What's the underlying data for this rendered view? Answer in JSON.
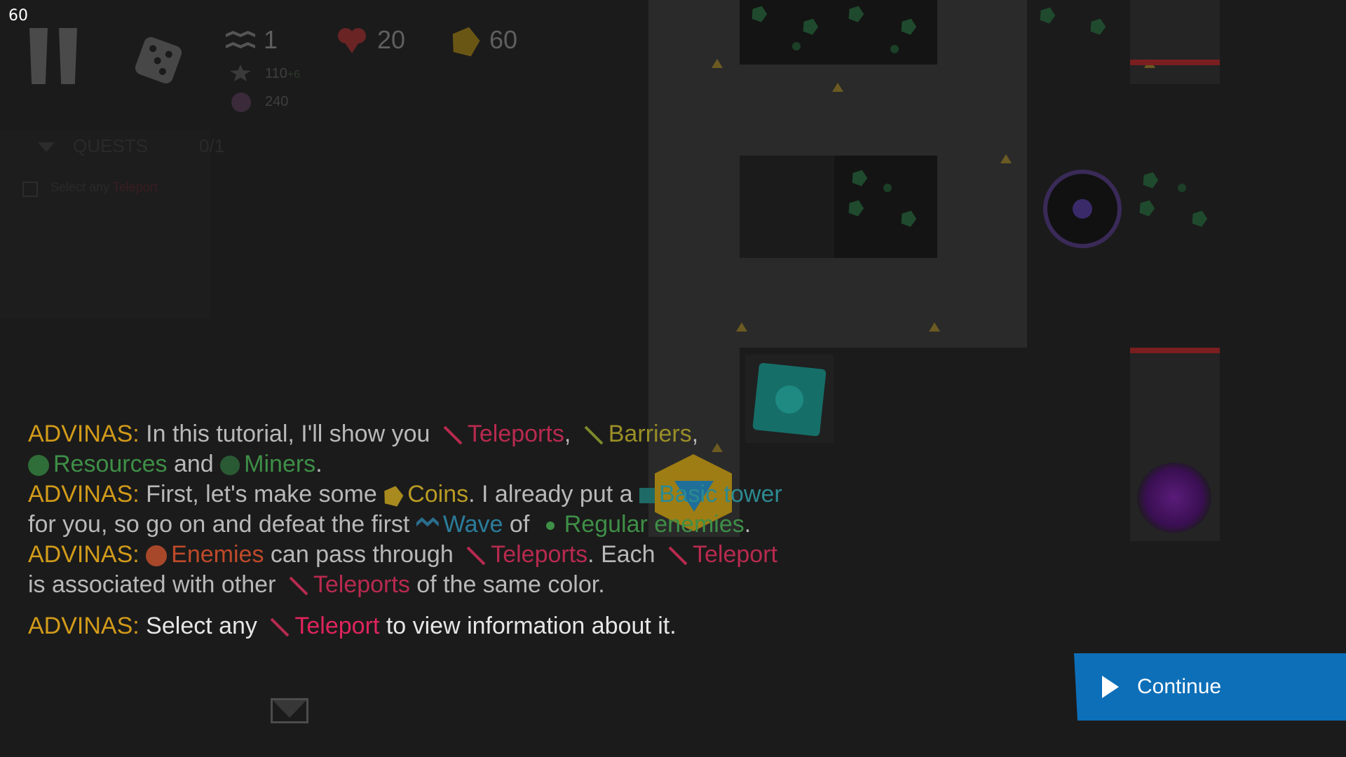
{
  "fps": "60",
  "hud": {
    "wave": "1",
    "lives": "20",
    "coins": "60",
    "score": "110",
    "score_bonus": "+6",
    "mops": "240"
  },
  "quests": {
    "title": "QUESTS",
    "progress": "0/1",
    "item": "Select any",
    "item_keyword": "Teleport"
  },
  "dialog": {
    "speaker": "ADVINAS:",
    "lines": [
      {
        "t1": "In this tutorial, I'll show you",
        "k1": "Teleports",
        "sep1": ",",
        "k2": "Barriers",
        "sep2": ",",
        "k3": "Resources",
        "t2": "and",
        "k4": "Miners",
        "end": "."
      },
      {
        "t1": "First, let's make some",
        "k1": "Coins",
        "t2": ". I already put a",
        "k2": "Basic tower",
        "t3": "for you, so go on and defeat the first",
        "k3": "Wave",
        "t4": "of",
        "k4": "Regular enemies",
        "end": "."
      },
      {
        "k1": "Enemies",
        "t1": "can pass through",
        "k2": "Teleports",
        "t2": ". Each",
        "k3": "Teleport",
        "t3": "is associated with other",
        "k4": "Teleports",
        "t4": "of the same color."
      },
      {
        "t1": "Select any",
        "k1": "Teleport",
        "t2": "to view information about it."
      }
    ]
  },
  "continue_label": "Continue",
  "icons": [
    "pause-icon",
    "dice-icon",
    "wave-icon",
    "heart-icon",
    "coin-icon",
    "mail-icon",
    "play-icon"
  ],
  "colors": {
    "speaker": "#d29b1a",
    "teleport": "#b82a4f",
    "continue_bg": "#0d6fb8"
  }
}
